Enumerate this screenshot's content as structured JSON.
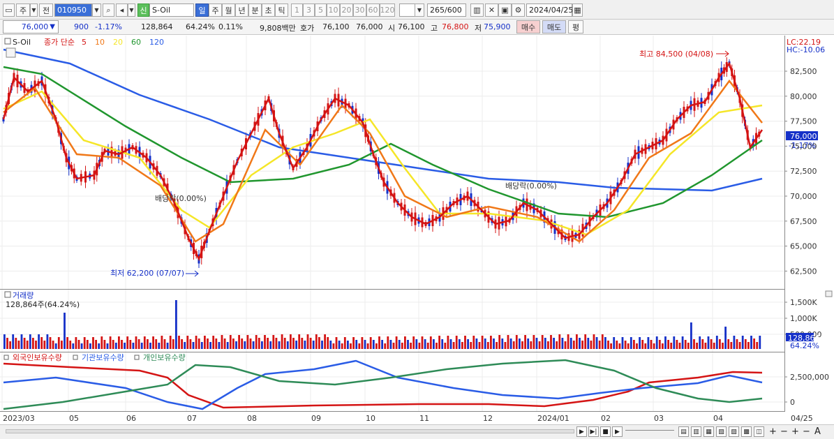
{
  "toolbar": {
    "type_label": "주",
    "prefix_label": "전",
    "code": "010950",
    "sin_badge": "신",
    "name": "S-Oil",
    "periods": [
      {
        "label": "일",
        "active": true
      },
      {
        "label": "주",
        "active": false
      },
      {
        "label": "월",
        "active": false
      },
      {
        "label": "년",
        "active": false
      },
      {
        "label": "분",
        "active": false
      },
      {
        "label": "초",
        "active": false
      },
      {
        "label": "틱",
        "active": false
      }
    ],
    "intervals": [
      "1",
      "3",
      "5",
      "10",
      "20",
      "30",
      "60",
      "120"
    ],
    "count": "265",
    "count_total": "/600",
    "date": "2024/04/25"
  },
  "info": {
    "price": "76,000",
    "change": "900",
    "pct": "-1.17%",
    "volume": "128,864",
    "vol_ratio": "64.24%",
    "turnover": "0.11%",
    "amount": "9,808백만",
    "ask_label": "호가",
    "ask1": "76,100",
    "ask2": "76,000",
    "open_label": "시",
    "open": "76,100",
    "high_label": "고",
    "high": "76,800",
    "low_label": "저",
    "low": "75,900",
    "buy_btn": "매수",
    "sell_btn": "매도",
    "eval_btn": "평"
  },
  "price_panel": {
    "legend_title": "S-Oil",
    "legend_ma": "종가 단순",
    "ma_periods": [
      "5",
      "10",
      "20",
      "60",
      "120"
    ],
    "ma_colors": [
      "#d41414",
      "#f07818",
      "#f5e628",
      "#20962e",
      "#2a5ce6"
    ],
    "lc_label": "LC:22.19",
    "hc_label": "HC:-10.06",
    "yaxis": [
      "82,500",
      "80,000",
      "77,500",
      "75,000",
      "72,500",
      "70,000",
      "67,500",
      "65,000",
      "62,500"
    ],
    "current_price": "76,000",
    "current_pct": "-1.17%",
    "high_note": "최고 84,500 (04/08)",
    "low_note": "최저 62,200 (07/07)",
    "div_note": "배당락(0.00%)"
  },
  "volume_panel": {
    "title": "거래량",
    "value": "128,864주(64.24%)",
    "yaxis": [
      "1,500K",
      "1,000K",
      "500,000"
    ],
    "current": "128,864",
    "current_pct": "64.24%"
  },
  "holding_panel": {
    "series": [
      {
        "name": "외국인보유수량",
        "color": "#d41414"
      },
      {
        "name": "기관보유수량",
        "color": "#2a5ce6"
      },
      {
        "name": "개인보유수량",
        "color": "#2e8b57"
      }
    ],
    "yaxis": [
      "2,500,000",
      "0"
    ]
  },
  "xaxis": [
    "2023/03",
    "05",
    "06",
    "07",
    "08",
    "09",
    "10",
    "11",
    "12",
    "2024/01",
    "02",
    "03",
    "04",
    "04/25"
  ]
}
